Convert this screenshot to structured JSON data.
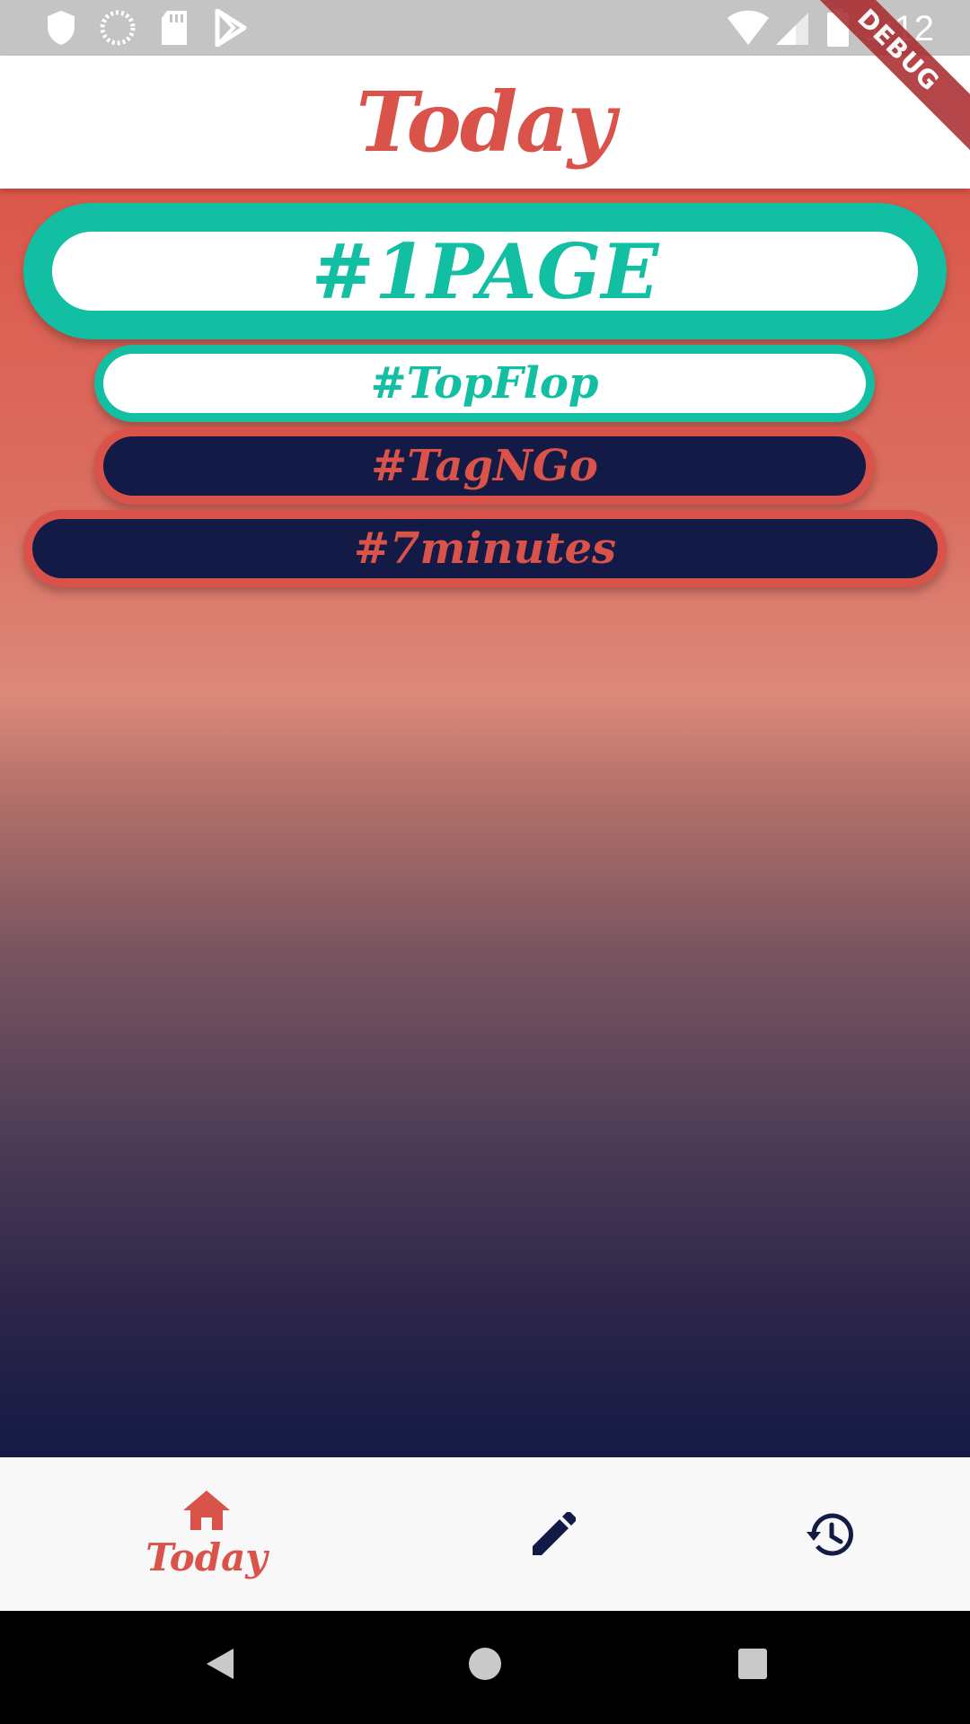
{
  "status_bar": {
    "time": "1:12",
    "left_icons": [
      "shield-icon",
      "loading-circle-icon",
      "sd-card-icon",
      "play-store-icon"
    ],
    "right_icons": [
      "wifi-icon",
      "cell-signal-icon",
      "battery-icon"
    ]
  },
  "debug_banner": "DEBUG",
  "app_bar": {
    "title": "Today"
  },
  "tags": [
    {
      "label": "#1PAGE",
      "text_color": "#12bfa3",
      "ring_color": "#12bfa3",
      "fill_color": "#ffffff"
    },
    {
      "label": "#TopFlop",
      "text_color": "#12bfa3",
      "ring_color": "#12bfa3",
      "fill_color": "#ffffff"
    },
    {
      "label": "#TagNGo",
      "text_color": "#d9534a",
      "ring_color": "#d9534a",
      "fill_color": "#131a45"
    },
    {
      "label": "#7minutes",
      "text_color": "#d9534a",
      "ring_color": "#d9534a",
      "fill_color": "#131a45"
    }
  ],
  "bottom_nav": {
    "items": [
      {
        "label": "Today",
        "icon": "home-icon",
        "active": true
      },
      {
        "label": "",
        "icon": "edit-pencil-icon",
        "active": false
      },
      {
        "label": "",
        "icon": "history-icon",
        "active": false
      }
    ]
  },
  "system_nav": {
    "icons": [
      "back-icon",
      "home-circle-icon",
      "recents-icon"
    ]
  },
  "colors": {
    "accent_red": "#d9534a",
    "teal": "#12bfa3",
    "navy": "#131a45",
    "status_bar_bg": "#c4c4c4",
    "nav_bg": "#f8f8f8"
  }
}
